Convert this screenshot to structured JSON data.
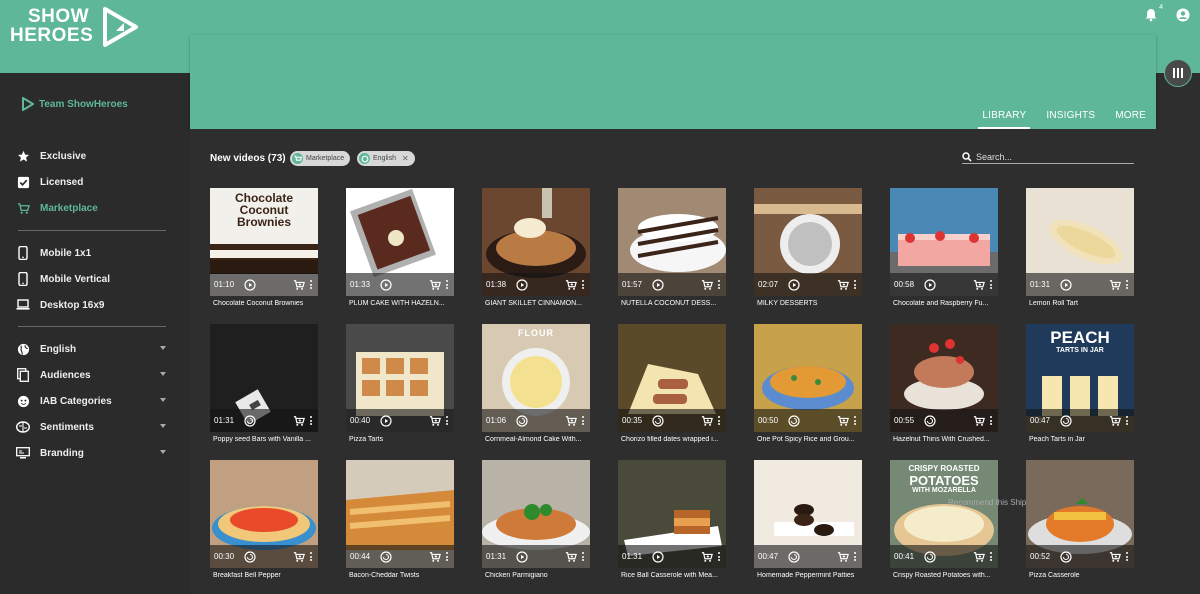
{
  "brand": {
    "logo_line1": "SHOW",
    "logo_line2": "HEROES",
    "primary": "#5fb79a"
  },
  "topbar": {
    "notification_count": "4"
  },
  "sidebar": {
    "team": "Team ShowHeroes",
    "group1": [
      {
        "label": "Exclusive",
        "icon": "star-icon"
      },
      {
        "label": "Licensed",
        "icon": "checkbox-icon"
      },
      {
        "label": "Marketplace",
        "icon": "cart-icon",
        "active": true
      }
    ],
    "group2": [
      {
        "label": "Mobile 1x1",
        "icon": "phone-icon"
      },
      {
        "label": "Mobile Vertical",
        "icon": "phone-icon"
      },
      {
        "label": "Desktop 16x9",
        "icon": "laptop-icon"
      }
    ],
    "group3": [
      {
        "label": "English",
        "icon": "globe-icon"
      },
      {
        "label": "Audiences",
        "icon": "copy-icon"
      },
      {
        "label": "IAB Categories",
        "icon": "face-icon"
      },
      {
        "label": "Sentiments",
        "icon": "brain-icon"
      },
      {
        "label": "Branding",
        "icon": "screen-icon"
      }
    ]
  },
  "tabs": [
    "LIBRARY",
    "INSIGHTS",
    "MORE"
  ],
  "content": {
    "heading": "New videos (73)",
    "chips": [
      "Marketplace",
      "English"
    ],
    "search_placeholder": "Search...",
    "overlay_text": "Recommend this Ship"
  },
  "videos": [
    {
      "duration": "01:10",
      "title": "Chocolate Coconut Brownies",
      "thumb_text": "Chocolate Coconut Brownies"
    },
    {
      "duration": "01:33",
      "title": "PLUM CAKE WITH HAZELN..."
    },
    {
      "duration": "01:38",
      "title": "GIANT SKILLET CINNAMON..."
    },
    {
      "duration": "01:57",
      "title": "NUTELLA COCONUT DESS..."
    },
    {
      "duration": "02:07",
      "title": "MILKY DESSERTS"
    },
    {
      "duration": "00:58",
      "title": "Chocolate and Raspberry Fu..."
    },
    {
      "duration": "01:31",
      "title": "Lemon Roll Tart"
    },
    {
      "duration": "01:31",
      "title": "Poppy seed Bars with Vanilla ..."
    },
    {
      "duration": "00:40",
      "title": "Pizza Tarts"
    },
    {
      "duration": "01:06",
      "title": "Cornmeal-Almond Cake With...",
      "thumb_text": "FLOUR"
    },
    {
      "duration": "00:35",
      "title": "Chorizo filled dates wrapped i..."
    },
    {
      "duration": "00:50",
      "title": "One Pot Spicy Rice and Grou..."
    },
    {
      "duration": "00:55",
      "title": "Hazelnut Thins With Crushed..."
    },
    {
      "duration": "00:47",
      "title": "Peach Tarts in Jar",
      "thumb_text": "PEACH",
      "thumb_sub": "TARTS IN JAR"
    },
    {
      "duration": "00:30",
      "title": "Breakfast Bell Pepper"
    },
    {
      "duration": "00:44",
      "title": "Bacon-Cheddar Twists"
    },
    {
      "duration": "01:31",
      "title": "Chicken Parmigiano"
    },
    {
      "duration": "01:31",
      "title": "Rice Ball Casserole with Mea..."
    },
    {
      "duration": "00:47",
      "title": "Homemade Peppermint Patties"
    },
    {
      "duration": "00:41",
      "title": "Crispy Roasted Potatoes with...",
      "thumb_text": "CRISPY ROASTED",
      "thumb_sub": "POTATOES",
      "thumb_sub2": "WITH MOZARELLA"
    },
    {
      "duration": "00:52",
      "title": "Pizza Casserole"
    }
  ]
}
